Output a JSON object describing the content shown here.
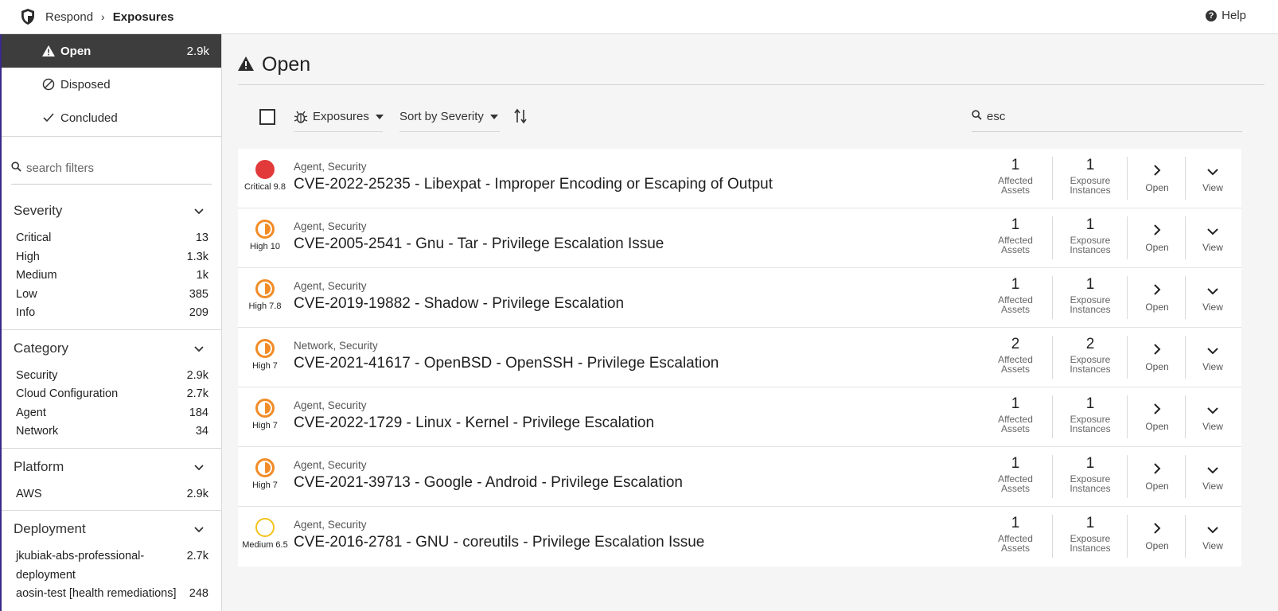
{
  "breadcrumb": {
    "parent": "Respond",
    "current": "Exposures"
  },
  "help_label": "Help",
  "statuses": [
    {
      "label": "Open",
      "count": "2.9k",
      "active": true
    },
    {
      "label": "Disposed",
      "count": "",
      "active": false
    },
    {
      "label": "Concluded",
      "count": "",
      "active": false
    }
  ],
  "filters": {
    "search_placeholder": "search filters",
    "groups": [
      {
        "title": "Severity",
        "rows": [
          {
            "label": "Critical",
            "value": "13"
          },
          {
            "label": "High",
            "value": "1.3k"
          },
          {
            "label": "Medium",
            "value": "1k"
          },
          {
            "label": "Low",
            "value": "385"
          },
          {
            "label": "Info",
            "value": "209"
          }
        ]
      },
      {
        "title": "Category",
        "rows": [
          {
            "label": "Security",
            "value": "2.9k"
          },
          {
            "label": "Cloud Configuration",
            "value": "2.7k"
          },
          {
            "label": "Agent",
            "value": "184"
          },
          {
            "label": "Network",
            "value": "34"
          }
        ]
      },
      {
        "title": "Platform",
        "rows": [
          {
            "label": "AWS",
            "value": "2.9k"
          }
        ]
      },
      {
        "title": "Deployment",
        "rows": [
          {
            "label": "jkubiak-abs-professional-",
            "value": "2.7k"
          },
          {
            "label": "deployment",
            "value": ""
          },
          {
            "label": "aosin-test [health remediations]",
            "value": "248"
          }
        ]
      }
    ]
  },
  "main": {
    "heading": "Open",
    "toolbar": {
      "type_label": "Exposures",
      "sort_label": "Sort by Severity",
      "search_value": "esc"
    },
    "labels": {
      "affected": [
        "Affected",
        "Assets"
      ],
      "instances": [
        "Exposure",
        "Instances"
      ],
      "open": "Open",
      "view": "View"
    },
    "rows": [
      {
        "severity": "critical",
        "severity_label": "Critical 9.8",
        "categories": "Agent, Security",
        "title": "CVE-2022-25235 - Libexpat - Improper Encoding or Escaping of Output",
        "affected": "1",
        "instances": "1"
      },
      {
        "severity": "high",
        "severity_label": "High 10",
        "categories": "Agent, Security",
        "title": "CVE-2005-2541 - Gnu - Tar - Privilege Escalation Issue",
        "affected": "1",
        "instances": "1"
      },
      {
        "severity": "high",
        "severity_label": "High 7.8",
        "categories": "Agent, Security",
        "title": "CVE-2019-19882 - Shadow - Privilege Escalation",
        "affected": "1",
        "instances": "1"
      },
      {
        "severity": "high",
        "severity_label": "High 7",
        "categories": "Network, Security",
        "title": "CVE-2021-41617 - OpenBSD - OpenSSH - Privilege Escalation",
        "affected": "2",
        "instances": "2"
      },
      {
        "severity": "high",
        "severity_label": "High 7",
        "categories": "Agent, Security",
        "title": "CVE-2022-1729 - Linux - Kernel - Privilege Escalation",
        "affected": "1",
        "instances": "1"
      },
      {
        "severity": "high",
        "severity_label": "High 7",
        "categories": "Agent, Security",
        "title": "CVE-2021-39713 - Google - Android - Privilege Escalation",
        "affected": "1",
        "instances": "1"
      },
      {
        "severity": "medium",
        "severity_label": "Medium 6.5",
        "categories": "Agent, Security",
        "title": "CVE-2016-2781 - GNU - coreutils - Privilege Escalation Issue",
        "affected": "1",
        "instances": "1"
      }
    ]
  }
}
